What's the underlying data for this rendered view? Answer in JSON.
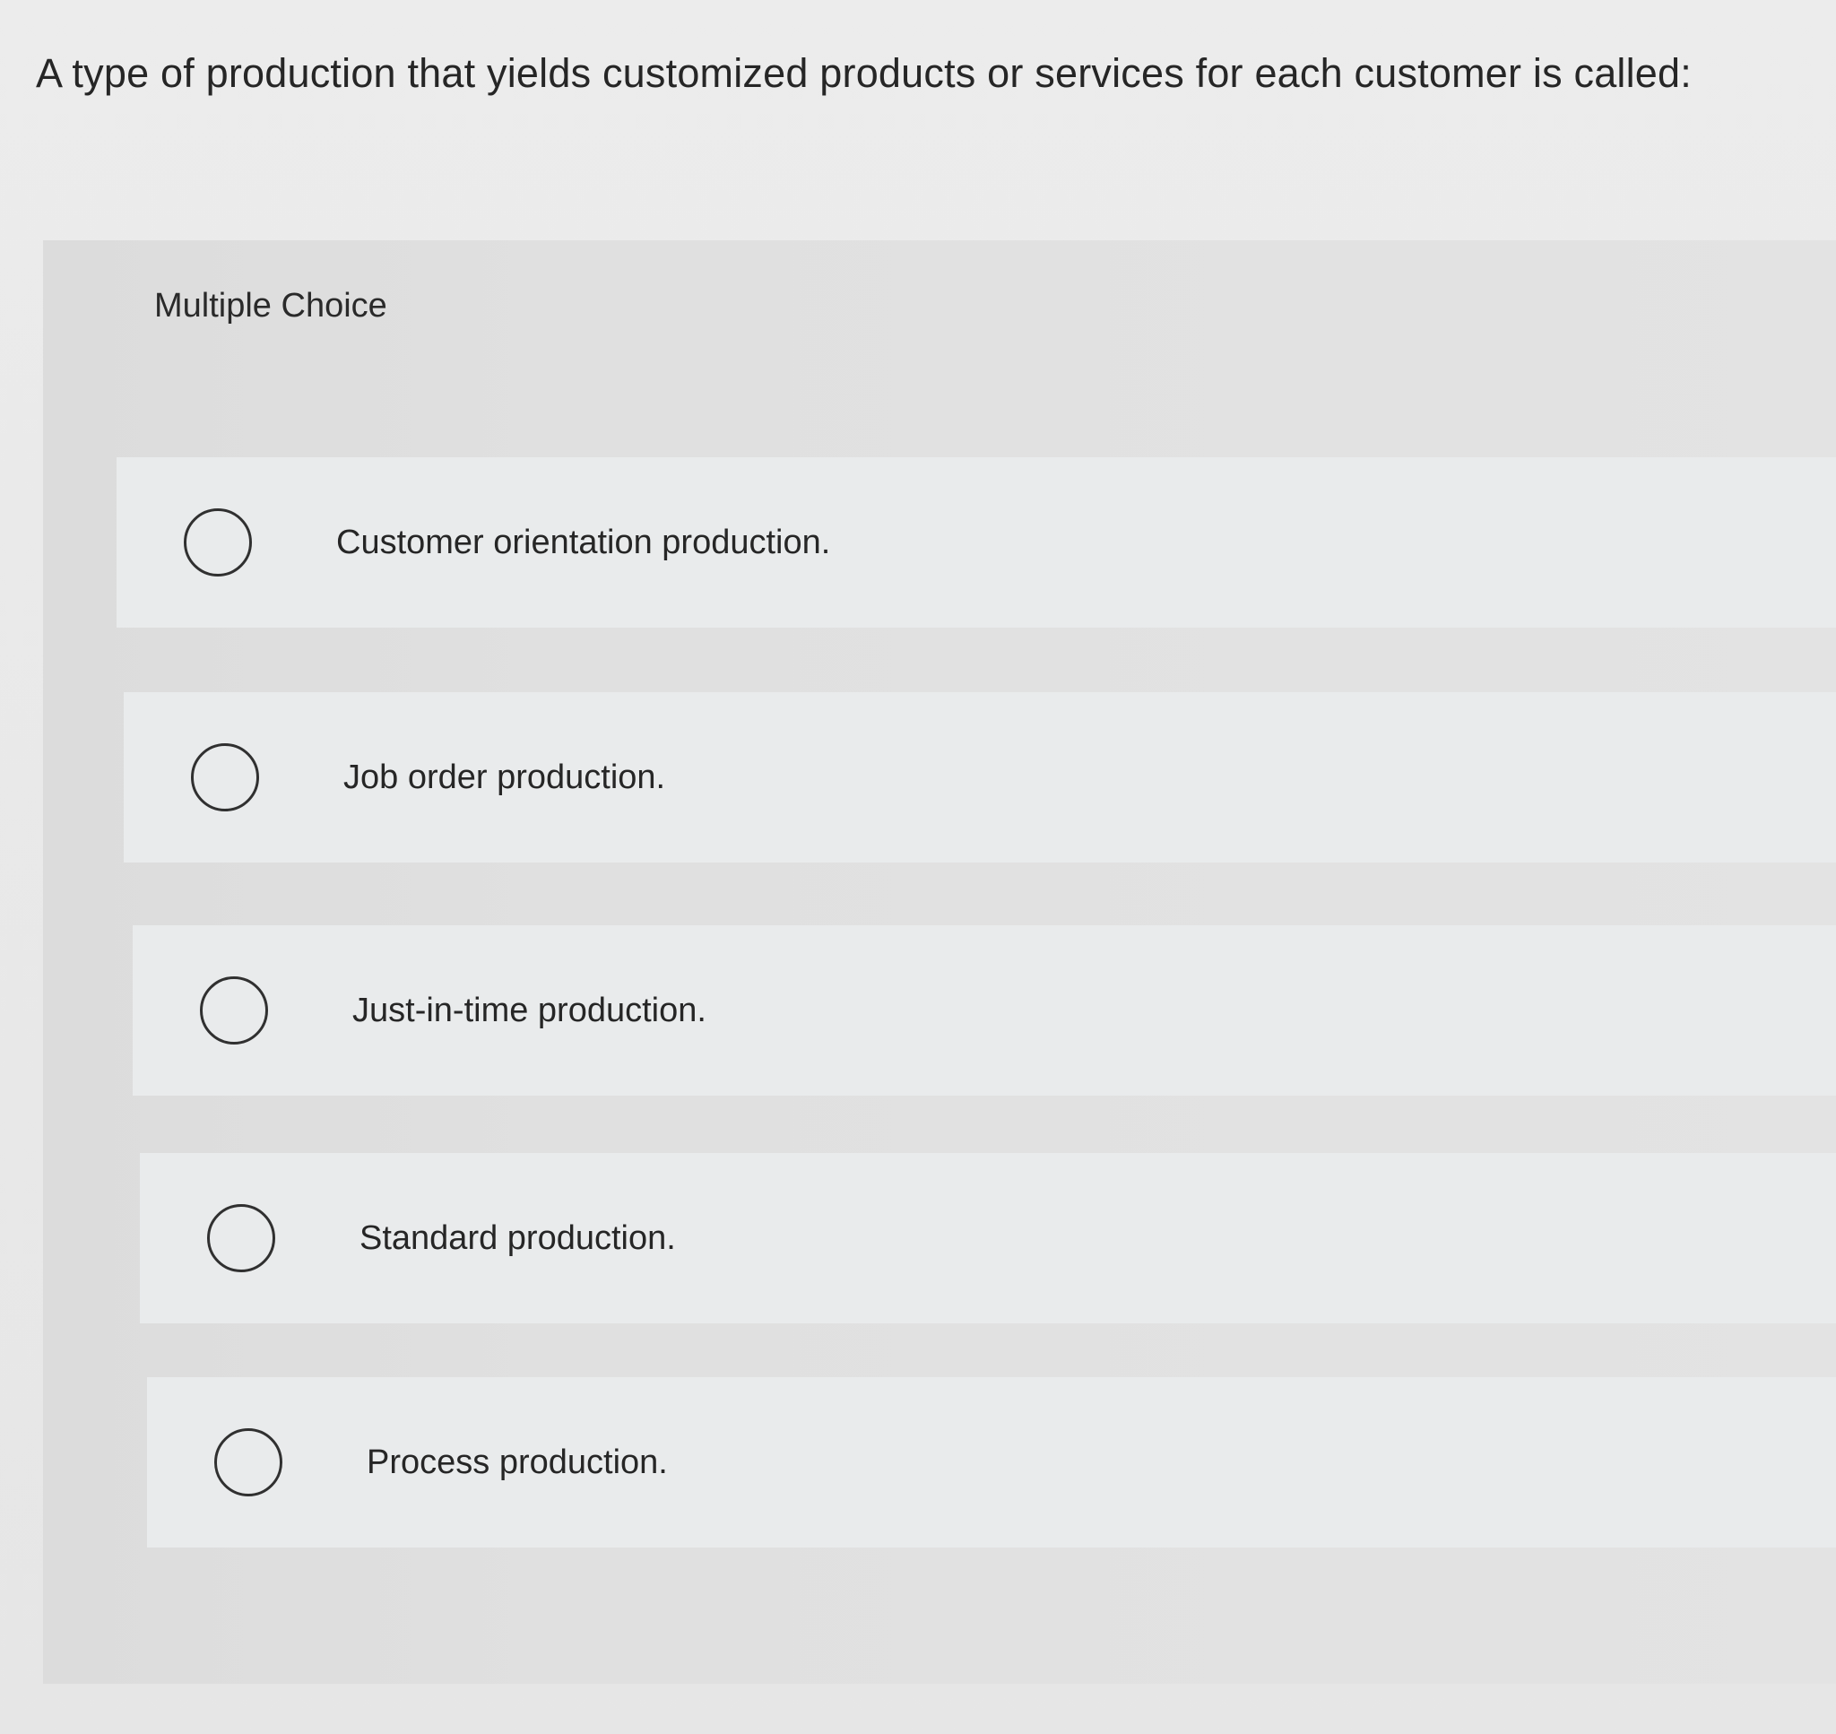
{
  "question": {
    "text": "A type of production that yields customized products or services for each customer is called:"
  },
  "panel": {
    "label": "Multiple Choice"
  },
  "choices": [
    {
      "label": "Customer orientation production.",
      "selected": false
    },
    {
      "label": "Job order production.",
      "selected": false
    },
    {
      "label": "Just-in-time production.",
      "selected": false
    },
    {
      "label": "Standard production.",
      "selected": false
    },
    {
      "label": "Process production.",
      "selected": false
    }
  ],
  "colors": {
    "background": "#e9e9e9",
    "panel": "#e0e0e0",
    "choice_row": "#e9ebec",
    "text": "#262626",
    "radio_border": "#303030"
  }
}
